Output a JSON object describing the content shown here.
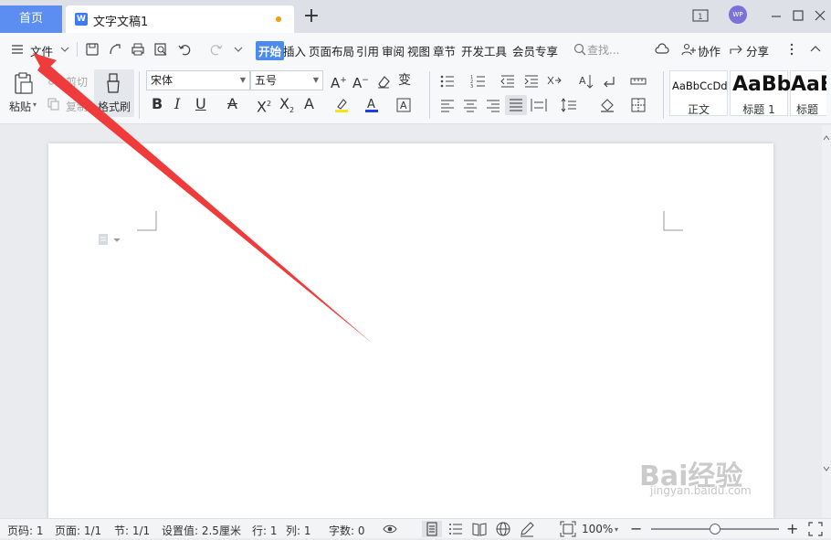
{
  "titlebar": {
    "home_tab": "首页",
    "doc_tab": "文字文稿1",
    "doc_logo": "W",
    "avatar": "WP"
  },
  "menu": {
    "file": "文件",
    "tabs": [
      "开始",
      "插入",
      "页面布局",
      "引用",
      "审阅",
      "视图",
      "章节",
      "开发工具",
      "会员专享"
    ],
    "search_placeholder": "查找...",
    "collaborate": "协作",
    "share": "分享"
  },
  "ribbon": {
    "paste": "粘贴",
    "cut": "剪切",
    "copy": "复制",
    "format_painter": "格式刷",
    "font_name": "宋体",
    "font_size": "五号",
    "styles": [
      {
        "sample": "AaBbCcDd",
        "name": "正文"
      },
      {
        "sample": "AaBb",
        "name": "标题 1"
      },
      {
        "sample": "AaE",
        "name": "标题"
      }
    ]
  },
  "status": {
    "page": "页码: 1",
    "pages": "页面: 1/1",
    "section": "节: 1/1",
    "setting": "设置值: 2.5厘米",
    "row": "行: 1",
    "col": "列: 1",
    "words": "字数: 0",
    "zoom": "100%",
    "zoom_fraction": 0.5
  },
  "watermark": {
    "brand": "Bai经验",
    "url": "jingyan.baidu.com"
  },
  "colors": {
    "accent": "#4c8af0",
    "home_tab": "#5b8ef0",
    "highlight": "#f5e21a",
    "font_color": "#1e3ee0",
    "annotation_arrow": "#ef3b3b"
  }
}
